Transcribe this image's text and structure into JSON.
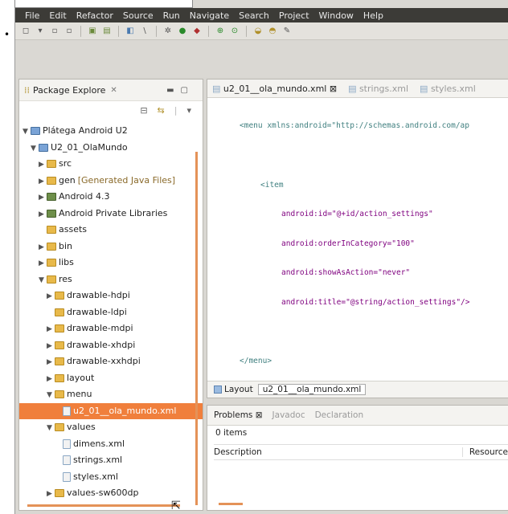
{
  "menubar": [
    "File",
    "Edit",
    "Refactor",
    "Source",
    "Run",
    "Navigate",
    "Search",
    "Project",
    "Window",
    "Help"
  ],
  "package_explorer": {
    "title": "Package Explore",
    "tree": [
      {
        "label": "Plátega Android U2",
        "depth": 0,
        "toggle": "▼",
        "icon": "proj"
      },
      {
        "label": "U2_01_OlaMundo",
        "depth": 1,
        "toggle": "▼",
        "icon": "proj"
      },
      {
        "label": "src",
        "depth": 2,
        "toggle": "▶",
        "icon": "folder"
      },
      {
        "label": "gen",
        "extra": "[Generated Java Files]",
        "depth": 2,
        "toggle": "▶",
        "icon": "folder"
      },
      {
        "label": "Android 4.3",
        "depth": 2,
        "toggle": "▶",
        "icon": "lib"
      },
      {
        "label": "Android Private Libraries",
        "depth": 2,
        "toggle": "▶",
        "icon": "lib"
      },
      {
        "label": "assets",
        "depth": 2,
        "toggle": "",
        "icon": "folder"
      },
      {
        "label": "bin",
        "depth": 2,
        "toggle": "▶",
        "icon": "folder"
      },
      {
        "label": "libs",
        "depth": 2,
        "toggle": "▶",
        "icon": "folder"
      },
      {
        "label": "res",
        "depth": 2,
        "toggle": "▼",
        "icon": "folder"
      },
      {
        "label": "drawable-hdpi",
        "depth": 3,
        "toggle": "▶",
        "icon": "folder"
      },
      {
        "label": "drawable-ldpi",
        "depth": 3,
        "toggle": "",
        "icon": "folder"
      },
      {
        "label": "drawable-mdpi",
        "depth": 3,
        "toggle": "▶",
        "icon": "folder"
      },
      {
        "label": "drawable-xhdpi",
        "depth": 3,
        "toggle": "▶",
        "icon": "folder"
      },
      {
        "label": "drawable-xxhdpi",
        "depth": 3,
        "toggle": "▶",
        "icon": "folder"
      },
      {
        "label": "layout",
        "depth": 3,
        "toggle": "▶",
        "icon": "folder"
      },
      {
        "label": "menu",
        "depth": 3,
        "toggle": "▼",
        "icon": "folder"
      },
      {
        "label": "u2_01__ola_mundo.xml",
        "depth": 4,
        "toggle": "",
        "icon": "file",
        "selected": true
      },
      {
        "label": "values",
        "depth": 3,
        "toggle": "▼",
        "icon": "folder"
      },
      {
        "label": "dimens.xml",
        "depth": 4,
        "toggle": "",
        "icon": "file"
      },
      {
        "label": "strings.xml",
        "depth": 4,
        "toggle": "",
        "icon": "file"
      },
      {
        "label": "styles.xml",
        "depth": 4,
        "toggle": "",
        "icon": "file"
      },
      {
        "label": "values-sw600dp",
        "depth": 3,
        "toggle": "▶",
        "icon": "folder"
      }
    ]
  },
  "editor": {
    "tabs": [
      {
        "label": "u2_01__ola_mundo.xml",
        "active": true
      },
      {
        "label": "strings.xml",
        "active": false
      },
      {
        "label": "styles.xml",
        "active": false
      }
    ],
    "code": {
      "menu_open": "<menu xmlns:android=\"http://schemas.android.com/ap",
      "item_open": "<item",
      "id": "android:id=\"@+id/action_settings\"",
      "order": "android:orderInCategory=\"100\"",
      "show": "android:showAsAction=\"never\"",
      "title": "android:title=\"@string/action_settings\"/>",
      "menu_close": "</menu>"
    },
    "bottom_tabs": {
      "layout": "Layout",
      "file": "u2_01__ola_mundo.xml"
    }
  },
  "problems": {
    "tabs": [
      "Problems",
      "Javadoc",
      "Declaration"
    ],
    "count": "0 items",
    "columns": [
      "Description",
      "Resource"
    ]
  }
}
